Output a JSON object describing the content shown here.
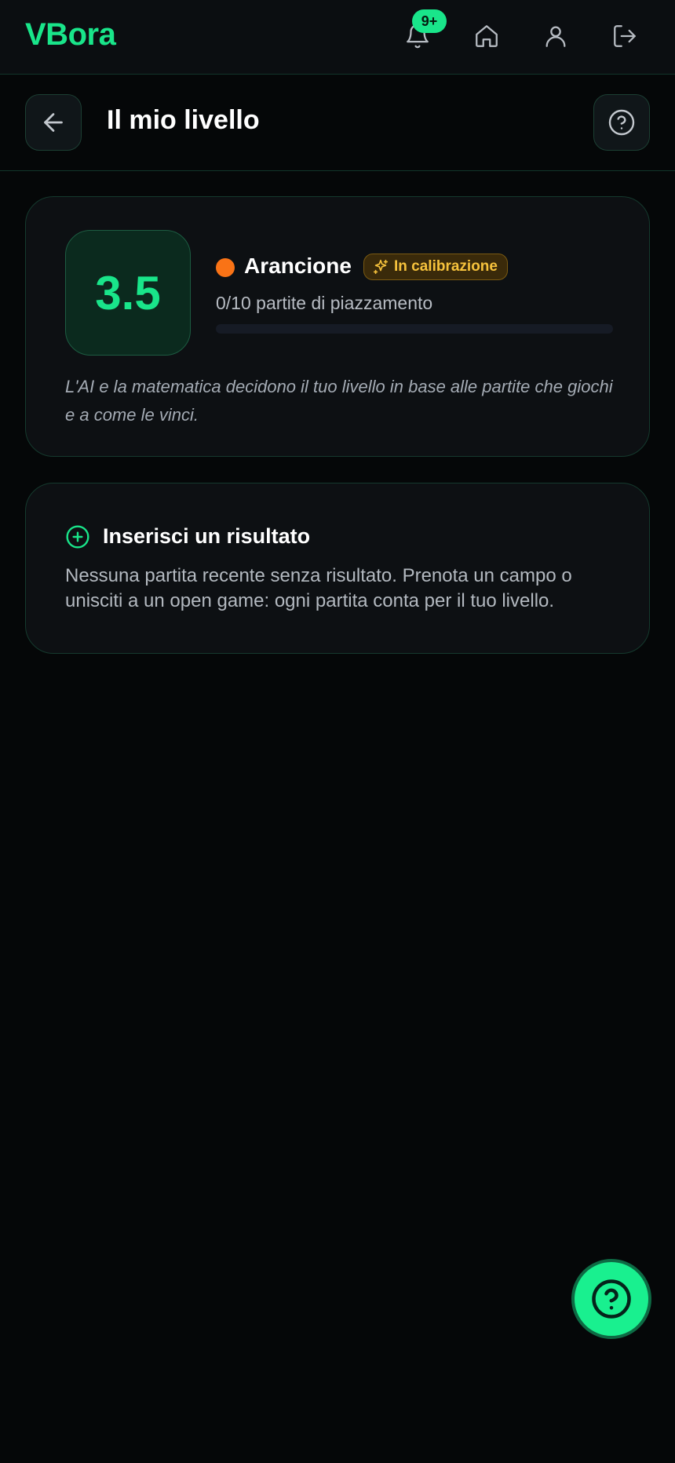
{
  "app": {
    "logo": "VBora",
    "notifications_badge": "9+",
    "accent_color": "#19e58a"
  },
  "nav": {
    "icons": [
      "bell-icon",
      "home-icon",
      "user-icon",
      "logout-icon"
    ]
  },
  "header": {
    "title": "Il mio livello",
    "back_icon": "arrow-left-icon",
    "help_icon": "help-circle-icon"
  },
  "level_card": {
    "level_value": "3.5",
    "tier_name": "Arancione",
    "tier_color": "#f97316",
    "status_badge": "In calibrazione",
    "status_icon": "sparkles-icon",
    "placement_text": "0/10 partite di piazzamento",
    "placement_progress": 0,
    "note": "L'AI e la matematica decidono il tuo livello in base alle partite che giochi e a come le vinci."
  },
  "result_card": {
    "title": "Inserisci un risultato",
    "title_icon": "plus-circle-icon",
    "body": "Nessuna partita recente senza risultato. Prenota un campo o unisciti a un open game: ogni partita conta per il tuo livello."
  },
  "fab": {
    "icon": "help-circle-icon"
  }
}
